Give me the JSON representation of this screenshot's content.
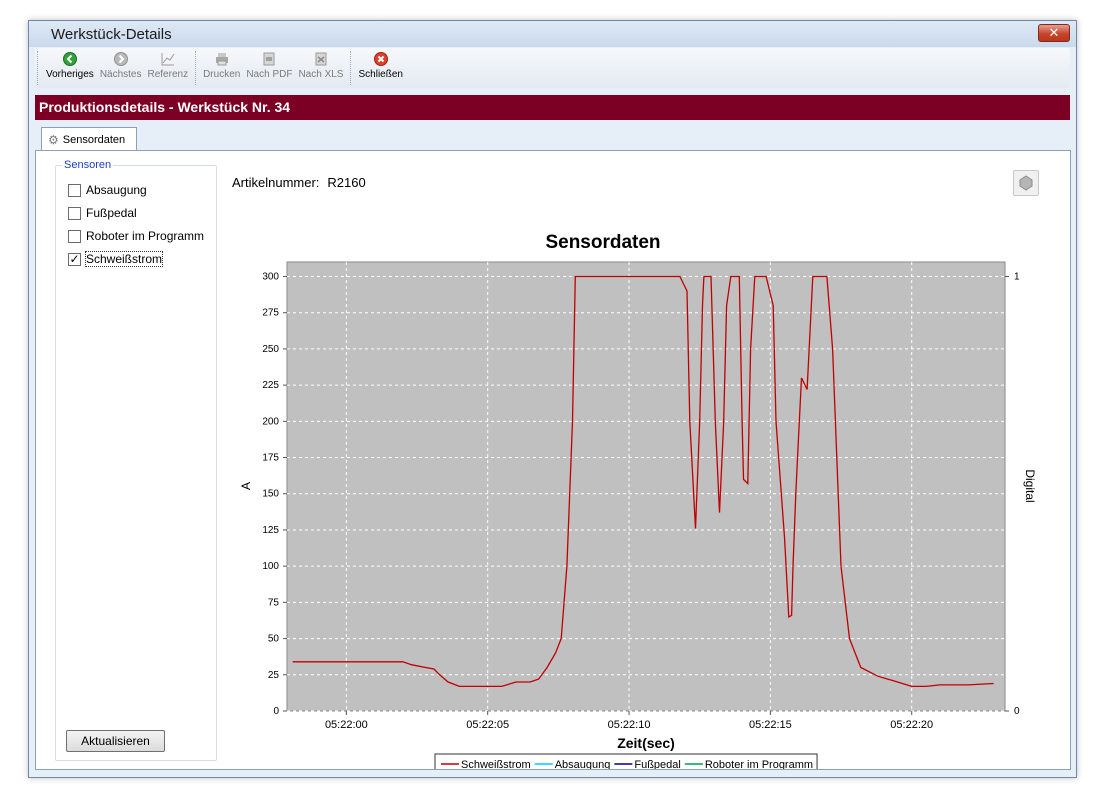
{
  "window": {
    "title": "Werkstück-Details",
    "close_label": "✕"
  },
  "toolbar": {
    "buttons": [
      {
        "label": "Vorheriges",
        "icon": "arrow-left-green-icon",
        "enabled": true
      },
      {
        "label": "Nächstes",
        "icon": "arrow-right-gray-icon",
        "enabled": false
      },
      {
        "label": "Referenz",
        "icon": "chart-icon",
        "enabled": false
      },
      {
        "label": "Drucken",
        "icon": "printer-icon",
        "enabled": false
      },
      {
        "label": "Nach PDF",
        "icon": "pdf-icon",
        "enabled": false
      },
      {
        "label": "Nach XLS",
        "icon": "xls-icon",
        "enabled": false
      },
      {
        "label": "Schließen",
        "icon": "close-red-icon",
        "enabled": true
      }
    ]
  },
  "header": {
    "title": "Produktionsdetails - Werkstück Nr. 34",
    "bg_color": "#7b0023"
  },
  "tabs": [
    {
      "label": "Sensordaten",
      "icon": "gear-icon",
      "active": true
    }
  ],
  "sensors": {
    "legend": "Sensoren",
    "items": [
      {
        "label": "Absaugung",
        "checked": false
      },
      {
        "label": "Fußpedal",
        "checked": false
      },
      {
        "label": "Roboter im Programm",
        "checked": false
      },
      {
        "label": "Schweißstrom",
        "checked": true
      }
    ],
    "refresh_label": "Aktualisieren"
  },
  "article": {
    "label": "Artikelnummer:",
    "value": "R2160"
  },
  "chart_data": {
    "type": "line",
    "title": "Sensordaten",
    "xlabel": "Zeit(sec)",
    "ylabel": "A",
    "y2label": "Digital",
    "ylim": [
      0,
      310
    ],
    "yticks": [
      0,
      25,
      50,
      75,
      100,
      125,
      150,
      175,
      200,
      225,
      250,
      275,
      300
    ],
    "y2ticks": [
      0,
      1
    ],
    "xlim": [
      -2.1,
      23.3
    ],
    "xticks": [
      {
        "value": 0,
        "label": "05:22:00"
      },
      {
        "value": 5,
        "label": "05:22:05"
      },
      {
        "value": 10,
        "label": "05:22:10"
      },
      {
        "value": 15,
        "label": "05:22:15"
      },
      {
        "value": 20,
        "label": "05:22:20"
      }
    ],
    "grid": true,
    "legend_position": "bottom",
    "series": [
      {
        "name": "Schweißstrom",
        "color": "#c00000",
        "x": [
          -1.9,
          2.0,
          2.3,
          2.8,
          3.1,
          3.3,
          3.6,
          4.0,
          4.5,
          5.5,
          6.0,
          6.5,
          6.8,
          7.1,
          7.4,
          7.6,
          7.8,
          8.0,
          8.1,
          9.0,
          10.5,
          11.6,
          11.8,
          12.05,
          12.15,
          12.35,
          12.5,
          12.6,
          12.65,
          12.8,
          12.9,
          13.05,
          13.2,
          13.35,
          13.45,
          13.6,
          13.75,
          13.9,
          14.0,
          14.05,
          14.2,
          14.3,
          14.45,
          14.55,
          14.7,
          14.85,
          15.1,
          15.2,
          15.5,
          15.65,
          15.75,
          15.8,
          15.9,
          16.0,
          16.1,
          16.3,
          16.5,
          17.0,
          17.2,
          17.5,
          17.8,
          18.2,
          18.8,
          19.5,
          20.0,
          20.5,
          21.0,
          22.0,
          22.9
        ],
        "y": [
          34,
          34,
          32,
          30,
          29,
          25,
          20,
          17,
          17,
          17,
          20,
          20,
          22,
          30,
          40,
          50,
          100,
          200,
          300,
          300,
          300,
          300,
          300,
          290,
          200,
          126,
          200,
          280,
          300,
          300,
          300,
          200,
          137,
          200,
          280,
          300,
          300,
          300,
          200,
          160,
          157,
          250,
          300,
          300,
          300,
          300,
          280,
          200,
          120,
          65,
          66,
          100,
          150,
          190,
          230,
          222,
          300,
          300,
          250,
          100,
          50,
          30,
          24,
          20,
          17,
          17,
          18,
          18,
          19
        ]
      },
      {
        "name": "Absaugung",
        "color": "#00c8ff",
        "x": [],
        "y": []
      },
      {
        "name": "Fußpedal",
        "color": "#000080",
        "x": [],
        "y": []
      },
      {
        "name": "Roboter im Programm",
        "color": "#00a050",
        "x": [],
        "y": []
      }
    ]
  }
}
